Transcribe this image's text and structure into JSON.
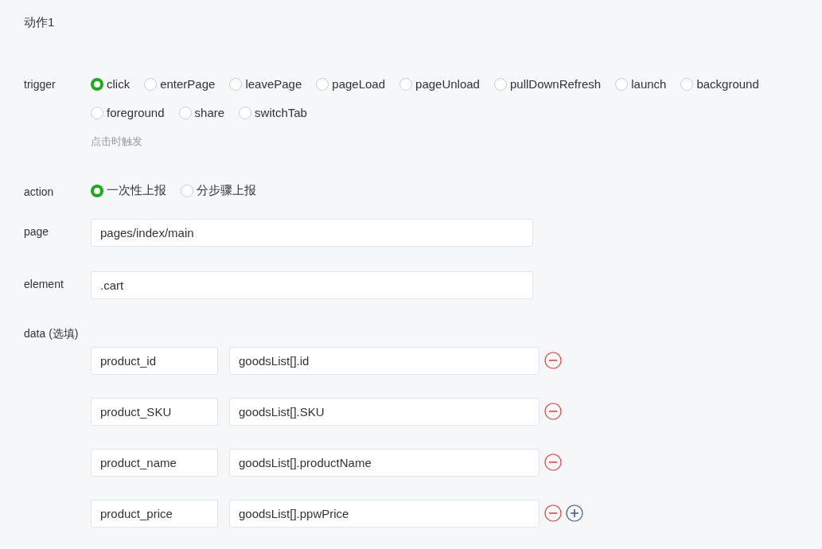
{
  "title": "动作1",
  "trigger": {
    "label": "trigger",
    "options": [
      {
        "label": "click",
        "selected": true
      },
      {
        "label": "enterPage",
        "selected": false
      },
      {
        "label": "leavePage",
        "selected": false
      },
      {
        "label": "pageLoad",
        "selected": false
      },
      {
        "label": "pageUnload",
        "selected": false
      },
      {
        "label": "pullDownRefresh",
        "selected": false
      },
      {
        "label": "launch",
        "selected": false
      },
      {
        "label": "background",
        "selected": false
      },
      {
        "label": "foreground",
        "selected": false
      },
      {
        "label": "share",
        "selected": false
      },
      {
        "label": "switchTab",
        "selected": false
      }
    ],
    "hint": "点击时触发"
  },
  "action": {
    "label": "action",
    "options": [
      {
        "label": "一次性上报",
        "selected": true
      },
      {
        "label": "分步骤上报",
        "selected": false
      }
    ]
  },
  "page": {
    "label": "page",
    "value": "pages/index/main"
  },
  "element": {
    "label": "element",
    "value": ".cart"
  },
  "data": {
    "label": "data (选填)",
    "rows": [
      {
        "key": "product_id",
        "value": "goodsList[].id"
      },
      {
        "key": "product_SKU",
        "value": "goodsList[].SKU"
      },
      {
        "key": "product_name",
        "value": "goodsList[].productName"
      },
      {
        "key": "product_price",
        "value": "goodsList[].ppwPrice"
      }
    ]
  }
}
